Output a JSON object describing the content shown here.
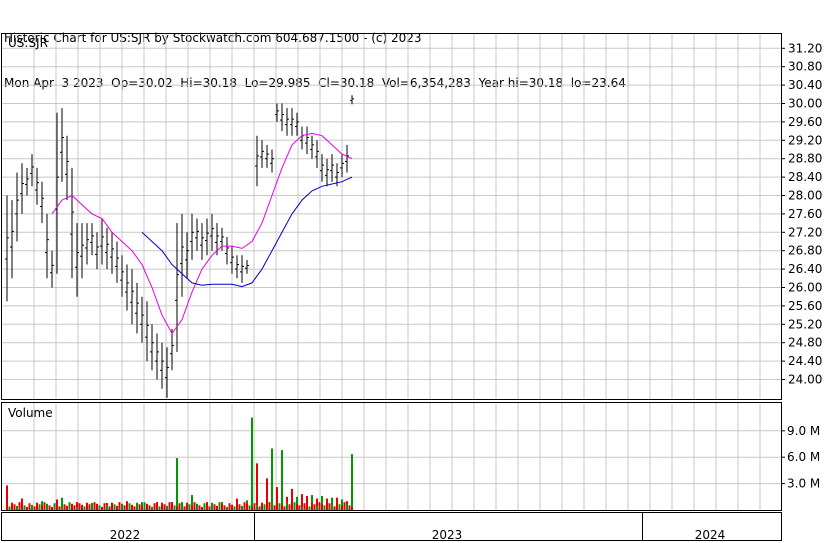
{
  "header": {
    "line1": "Historic Chart for US:SJR by Stockwatch.com 604.687.1500 - (c) 2023",
    "line2": "Mon Apr  3 2023  Op=30.02  Hi=30.18  Lo=29.985  Cl=30.18  Vol=6,354,283  Year hi=30.18  lo=23.64"
  },
  "chart_data": [
    {
      "type": "line",
      "label": "US:SJR",
      "y_ticks": [
        "31.20",
        "30.80",
        "30.40",
        "30.00",
        "29.60",
        "29.20",
        "28.80",
        "28.40",
        "28.00",
        "27.60",
        "27.20",
        "26.80",
        "26.40",
        "26.00",
        "25.60",
        "25.20",
        "24.80",
        "24.40",
        "24.00"
      ],
      "ylim": [
        23.6,
        31.5
      ],
      "price_bars": [
        {
          "w": 1,
          "hl": [
            25.7,
            28.0
          ]
        },
        {
          "w": 2,
          "hl": [
            26.2,
            27.9
          ]
        },
        {
          "w": 3,
          "hl": [
            27.0,
            28.5
          ]
        },
        {
          "w": 4,
          "hl": [
            27.6,
            28.7
          ]
        },
        {
          "w": 5,
          "hl": [
            28.0,
            28.6
          ]
        },
        {
          "w": 6,
          "hl": [
            28.2,
            28.9
          ]
        },
        {
          "w": 7,
          "hl": [
            27.8,
            28.6
          ]
        },
        {
          "w": 8,
          "hl": [
            27.4,
            28.3
          ]
        },
        {
          "w": 9,
          "hl": [
            26.2,
            27.6
          ]
        },
        {
          "w": 10,
          "hl": [
            26.0,
            26.8
          ]
        },
        {
          "w": 11,
          "hl": [
            26.3,
            29.8
          ]
        },
        {
          "w": 12,
          "hl": [
            28.3,
            29.9
          ]
        },
        {
          "w": 13,
          "hl": [
            27.9,
            29.3
          ]
        },
        {
          "w": 14,
          "hl": [
            26.2,
            28.6
          ]
        },
        {
          "w": 15,
          "hl": [
            25.8,
            27.4
          ]
        },
        {
          "w": 16,
          "hl": [
            26.2,
            27.4
          ]
        },
        {
          "w": 17,
          "hl": [
            26.5,
            27.4
          ]
        },
        {
          "w": 18,
          "hl": [
            26.7,
            27.4
          ]
        },
        {
          "w": 19,
          "hl": [
            26.4,
            27.2
          ]
        },
        {
          "w": 20,
          "hl": [
            26.5,
            27.5
          ]
        },
        {
          "w": 21,
          "hl": [
            26.4,
            27.3
          ]
        },
        {
          "w": 22,
          "hl": [
            26.3,
            27.2
          ]
        },
        {
          "w": 23,
          "hl": [
            26.1,
            27.0
          ]
        },
        {
          "w": 24,
          "hl": [
            25.8,
            26.7
          ]
        },
        {
          "w": 25,
          "hl": [
            25.5,
            26.5
          ]
        },
        {
          "w": 26,
          "hl": [
            25.2,
            26.4
          ]
        },
        {
          "w": 27,
          "hl": [
            25.0,
            26.1
          ]
        },
        {
          "w": 28,
          "hl": [
            24.8,
            25.8
          ]
        },
        {
          "w": 29,
          "hl": [
            24.4,
            25.7
          ]
        },
        {
          "w": 30,
          "hl": [
            24.2,
            25.2
          ]
        },
        {
          "w": 31,
          "hl": [
            24.0,
            25.0
          ]
        },
        {
          "w": 32,
          "hl": [
            23.8,
            24.8
          ]
        },
        {
          "w": 33,
          "hl": [
            23.6,
            24.7
          ]
        },
        {
          "w": 34,
          "hl": [
            24.2,
            25.1
          ]
        },
        {
          "w": 35,
          "hl": [
            24.6,
            27.4
          ]
        },
        {
          "w": 36,
          "hl": [
            25.8,
            27.6
          ]
        },
        {
          "w": 37,
          "hl": [
            26.2,
            27.2
          ]
        },
        {
          "w": 38,
          "hl": [
            26.6,
            27.6
          ]
        },
        {
          "w": 39,
          "hl": [
            26.8,
            27.5
          ]
        },
        {
          "w": 40,
          "hl": [
            26.6,
            27.4
          ]
        },
        {
          "w": 41,
          "hl": [
            26.7,
            27.5
          ]
        },
        {
          "w": 42,
          "hl": [
            26.8,
            27.6
          ]
        },
        {
          "w": 43,
          "hl": [
            26.7,
            27.4
          ]
        },
        {
          "w": 44,
          "hl": [
            26.8,
            27.3
          ]
        },
        {
          "w": 45,
          "hl": [
            26.5,
            27.1
          ]
        },
        {
          "w": 46,
          "hl": [
            26.3,
            26.9
          ]
        },
        {
          "w": 47,
          "hl": [
            26.2,
            26.7
          ]
        },
        {
          "w": 48,
          "hl": [
            26.1,
            26.7
          ]
        },
        {
          "w": 49,
          "hl": [
            26.3,
            26.6
          ]
        },
        {
          "w": 51,
          "hl": [
            28.2,
            29.3
          ]
        },
        {
          "w": 52,
          "hl": [
            28.6,
            29.2
          ]
        },
        {
          "w": 53,
          "hl": [
            28.6,
            29.1
          ]
        },
        {
          "w": 54,
          "hl": [
            28.5,
            29.0
          ]
        },
        {
          "w": 55,
          "hl": [
            29.6,
            30.0
          ]
        },
        {
          "w": 56,
          "hl": [
            29.4,
            30.0
          ]
        },
        {
          "w": 57,
          "hl": [
            29.3,
            29.9
          ]
        },
        {
          "w": 58,
          "hl": [
            29.3,
            29.9
          ]
        },
        {
          "w": 59,
          "hl": [
            29.3,
            29.8
          ]
        },
        {
          "w": 60,
          "hl": [
            29.0,
            29.5
          ]
        },
        {
          "w": 61,
          "hl": [
            28.9,
            29.5
          ]
        },
        {
          "w": 62,
          "hl": [
            28.8,
            29.3
          ]
        },
        {
          "w": 63,
          "hl": [
            28.6,
            29.2
          ]
        },
        {
          "w": 64,
          "hl": [
            28.3,
            28.9
          ]
        },
        {
          "w": 65,
          "hl": [
            28.2,
            28.8
          ]
        },
        {
          "w": 66,
          "hl": [
            28.3,
            28.9
          ]
        },
        {
          "w": 67,
          "hl": [
            28.2,
            28.7
          ]
        },
        {
          "w": 68,
          "hl": [
            28.4,
            28.9
          ]
        },
        {
          "w": 69,
          "hl": [
            28.5,
            29.1
          ]
        },
        {
          "w": 70,
          "hl": [
            29.985,
            30.18
          ]
        }
      ],
      "ma_short": [
        {
          "w": 10,
          "v": 27.6
        },
        {
          "w": 12,
          "v": 27.9
        },
        {
          "w": 14,
          "v": 28.0
        },
        {
          "w": 16,
          "v": 27.8
        },
        {
          "w": 18,
          "v": 27.6
        },
        {
          "w": 20,
          "v": 27.5
        },
        {
          "w": 22,
          "v": 27.2
        },
        {
          "w": 24,
          "v": 27.0
        },
        {
          "w": 26,
          "v": 26.8
        },
        {
          "w": 28,
          "v": 26.5
        },
        {
          "w": 30,
          "v": 26.0
        },
        {
          "w": 32,
          "v": 25.4
        },
        {
          "w": 34,
          "v": 25.0
        },
        {
          "w": 36,
          "v": 25.3
        },
        {
          "w": 38,
          "v": 25.9
        },
        {
          "w": 40,
          "v": 26.4
        },
        {
          "w": 42,
          "v": 26.7
        },
        {
          "w": 44,
          "v": 26.9
        },
        {
          "w": 46,
          "v": 26.9
        },
        {
          "w": 48,
          "v": 26.85
        },
        {
          "w": 50,
          "v": 27.0
        },
        {
          "w": 52,
          "v": 27.4
        },
        {
          "w": 54,
          "v": 28.0
        },
        {
          "w": 56,
          "v": 28.6
        },
        {
          "w": 58,
          "v": 29.1
        },
        {
          "w": 60,
          "v": 29.3
        },
        {
          "w": 62,
          "v": 29.35
        },
        {
          "w": 64,
          "v": 29.3
        },
        {
          "w": 66,
          "v": 29.1
        },
        {
          "w": 68,
          "v": 28.9
        },
        {
          "w": 70,
          "v": 28.8
        }
      ],
      "ma_long": [
        {
          "w": 28,
          "v": 27.2
        },
        {
          "w": 30,
          "v": 27.0
        },
        {
          "w": 32,
          "v": 26.8
        },
        {
          "w": 34,
          "v": 26.5
        },
        {
          "w": 36,
          "v": 26.3
        },
        {
          "w": 38,
          "v": 26.1
        },
        {
          "w": 40,
          "v": 26.05
        },
        {
          "w": 42,
          "v": 26.07
        },
        {
          "w": 44,
          "v": 26.07
        },
        {
          "w": 46,
          "v": 26.07
        },
        {
          "w": 48,
          "v": 26.02
        },
        {
          "w": 50,
          "v": 26.1
        },
        {
          "w": 52,
          "v": 26.4
        },
        {
          "w": 54,
          "v": 26.8
        },
        {
          "w": 56,
          "v": 27.2
        },
        {
          "w": 58,
          "v": 27.6
        },
        {
          "w": 60,
          "v": 27.9
        },
        {
          "w": 62,
          "v": 28.1
        },
        {
          "w": 64,
          "v": 28.2
        },
        {
          "w": 66,
          "v": 28.25
        },
        {
          "w": 68,
          "v": 28.3
        },
        {
          "w": 70,
          "v": 28.4
        }
      ]
    },
    {
      "type": "bar",
      "label": "Volume",
      "y_ticks": [
        "9.0 M",
        "6.0 M",
        "3.0 M"
      ],
      "ylim": [
        0,
        12
      ],
      "volume_bars": [
        {
          "w": 1,
          "v": 2.8,
          "c": "r"
        },
        {
          "w": 4,
          "v": 1.3,
          "c": "r"
        },
        {
          "w": 8,
          "v": 1.0,
          "c": "g"
        },
        {
          "w": 11,
          "v": 1.2,
          "c": "r"
        },
        {
          "w": 12,
          "v": 1.4,
          "c": "g"
        },
        {
          "w": 15,
          "v": 0.9,
          "c": "r"
        },
        {
          "w": 18,
          "v": 0.8,
          "c": "g"
        },
        {
          "w": 21,
          "v": 0.8,
          "c": "r"
        },
        {
          "w": 25,
          "v": 1.0,
          "c": "r"
        },
        {
          "w": 28,
          "v": 0.9,
          "c": "g"
        },
        {
          "w": 31,
          "v": 0.9,
          "c": "r"
        },
        {
          "w": 34,
          "v": 0.9,
          "c": "r"
        },
        {
          "w": 35,
          "v": 5.9,
          "c": "g"
        },
        {
          "w": 36,
          "v": 0.9,
          "c": "g"
        },
        {
          "w": 38,
          "v": 1.7,
          "c": "g"
        },
        {
          "w": 41,
          "v": 0.9,
          "c": "r"
        },
        {
          "w": 44,
          "v": 0.9,
          "c": "g"
        },
        {
          "w": 47,
          "v": 1.3,
          "c": "r"
        },
        {
          "w": 49,
          "v": 1.1,
          "c": "g"
        },
        {
          "w": 50,
          "v": 10.5,
          "c": "g"
        },
        {
          "w": 51,
          "v": 5.3,
          "c": "r"
        },
        {
          "w": 53,
          "v": 3.6,
          "c": "r"
        },
        {
          "w": 54,
          "v": 7.0,
          "c": "g"
        },
        {
          "w": 55,
          "v": 2.6,
          "c": "r"
        },
        {
          "w": 56,
          "v": 6.8,
          "c": "g"
        },
        {
          "w": 57,
          "v": 1.5,
          "c": "r"
        },
        {
          "w": 58,
          "v": 2.4,
          "c": "r"
        },
        {
          "w": 59,
          "v": 1.5,
          "c": "g"
        },
        {
          "w": 60,
          "v": 1.8,
          "c": "r"
        },
        {
          "w": 61,
          "v": 1.6,
          "c": "r"
        },
        {
          "w": 62,
          "v": 1.7,
          "c": "g"
        },
        {
          "w": 63,
          "v": 1.3,
          "c": "r"
        },
        {
          "w": 64,
          "v": 1.6,
          "c": "g"
        },
        {
          "w": 65,
          "v": 1.3,
          "c": "r"
        },
        {
          "w": 66,
          "v": 1.4,
          "c": "g"
        },
        {
          "w": 67,
          "v": 1.4,
          "c": "r"
        },
        {
          "w": 68,
          "v": 1.2,
          "c": "g"
        },
        {
          "w": 69,
          "v": 1.0,
          "c": "r"
        },
        {
          "w": 70,
          "v": 6.35,
          "c": "g"
        }
      ]
    }
  ],
  "x_labels": [
    "2022",
    "2023",
    "2024"
  ],
  "colors": {
    "price": "#000000",
    "ma_short": "#e600e6",
    "ma_long": "#0000cc",
    "vol_up": "#009900",
    "vol_down": "#e60000",
    "grid": "#c8c8c8",
    "frame": "#000000"
  }
}
